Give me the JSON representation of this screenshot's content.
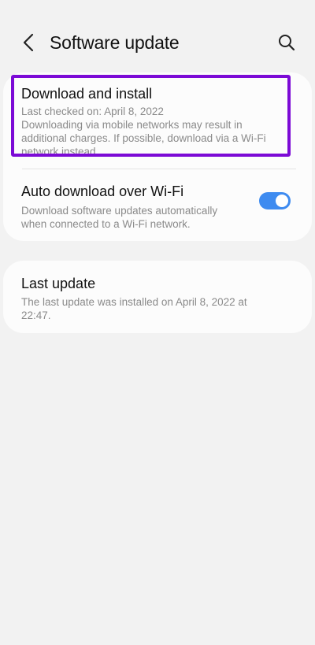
{
  "header": {
    "title": "Software update",
    "back_icon": "chevron-left-icon",
    "search_icon": "search-icon"
  },
  "download_install": {
    "title": "Download and install",
    "last_checked": "Last checked on: April 8, 2022",
    "note_line1": "Downloading via mobile networks may result in",
    "note_line2": "additional charges. If possible, download via a Wi-Fi",
    "note_line3": "network instead."
  },
  "auto_download": {
    "title": "Auto download over Wi-Fi",
    "desc_line1": "Download software updates automatically",
    "desc_line2": "when connected to a Wi-Fi network.",
    "enabled": true
  },
  "last_update": {
    "title": "Last update",
    "desc_line1": "The last update was installed on April 8, 2022 at",
    "desc_line2": "22:47."
  },
  "colors": {
    "background": "#f2f2f2",
    "card": "#fcfcfc",
    "highlight": "#7c0ad6",
    "toggle_on": "#3e8bf0",
    "secondary_text": "#8a8a8a"
  }
}
